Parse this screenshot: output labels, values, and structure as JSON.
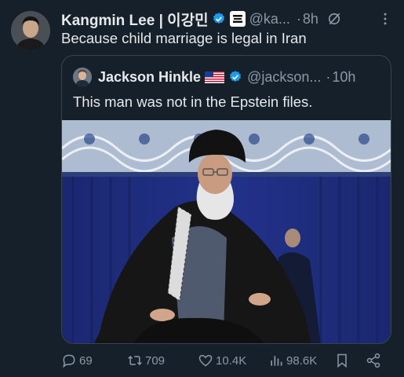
{
  "author": {
    "name": "Kangmin Lee | 이강민",
    "handle": "@ka...",
    "time": "8h",
    "separator": "·",
    "avatar": "profile-photo"
  },
  "tweet": {
    "text": "Because child marriage is legal in Iran"
  },
  "quoted": {
    "name": "Jackson Hinkle",
    "handle": "@jackson...",
    "separator": "·",
    "time": "10h",
    "text": "This man was not in the Epstein files.",
    "flag": "us-flag-icon",
    "media": "photo-of-man-in-black-turban-seated-on-chair"
  },
  "actions": {
    "reply_count": "69",
    "retweet_count": "709",
    "like_count": "10.4K",
    "view_count": "98.6K"
  },
  "colors": {
    "background": "#15202b",
    "text": "#e7e9ea",
    "muted": "#8b98a5",
    "verified": "#1d9bf0",
    "border": "#38444d"
  }
}
